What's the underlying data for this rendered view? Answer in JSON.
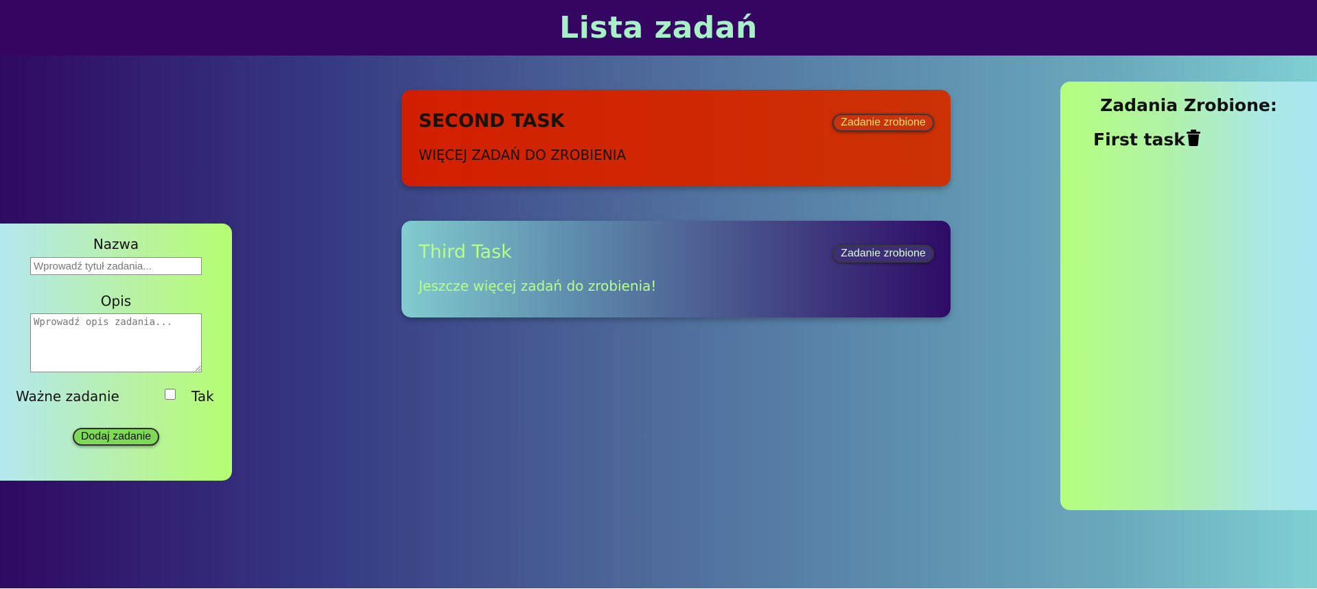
{
  "header": {
    "title": "Lista zadań"
  },
  "form": {
    "name_label": "Nazwa",
    "name_placeholder": "Wprowadź tytuł zadania...",
    "name_value": "",
    "desc_label": "Opis",
    "desc_placeholder": "Wprowadź opis zadania...",
    "desc_value": "",
    "important_label": "Ważne zadanie",
    "important_checked": false,
    "yes_label": "Tak",
    "add_button": "Dodaj zadanie"
  },
  "tasks": [
    {
      "title": "SECOND TASK",
      "description": "WIĘCEJ ZADAŃ DO ZROBIENIA",
      "done_button": "Zadanie zrobione",
      "color": "#d21e00"
    },
    {
      "title": "Third Task",
      "description": "Jeszcze więcej zadań do zrobienia!",
      "done_button": "Zadanie zrobione",
      "color": "#2e0b66"
    }
  ],
  "done_panel": {
    "heading": "Zadania Zrobione:",
    "items": [
      {
        "label": "First task",
        "icon": "trash-icon"
      }
    ]
  },
  "colors": {
    "header_bg": "#340662",
    "header_text": "#a8f0c8",
    "accent_green": "#7ed957"
  }
}
